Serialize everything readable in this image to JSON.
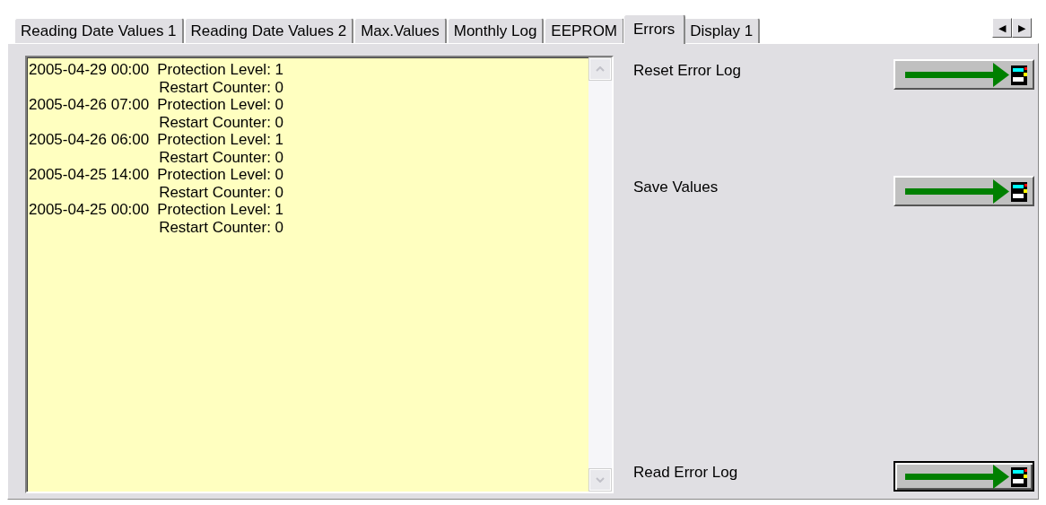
{
  "tabs": [
    {
      "label": "Reading Date Values 1",
      "selected": false
    },
    {
      "label": "Reading Date Values 2",
      "selected": false
    },
    {
      "label": "Max.Values",
      "selected": false
    },
    {
      "label": "Monthly Log",
      "selected": false
    },
    {
      "label": "EEPROM",
      "selected": false
    },
    {
      "label": "Errors",
      "selected": true
    },
    {
      "label": "Display 1",
      "selected": false
    }
  ],
  "tab_scroll": {
    "left": "◀",
    "right": "▶"
  },
  "error_log": [
    {
      "time": "2005-04-29 00:00",
      "protection": "Protection Level: 1",
      "restart": "Restart Counter: 0"
    },
    {
      "time": "2005-04-26 07:00",
      "protection": "Protection Level: 0",
      "restart": "Restart Counter: 0"
    },
    {
      "time": "2005-04-26 06:00",
      "protection": "Protection Level: 1",
      "restart": "Restart Counter: 0"
    },
    {
      "time": "2005-04-25 14:00",
      "protection": "Protection Level: 0",
      "restart": "Restart Counter: 0"
    },
    {
      "time": "2005-04-25 00:00",
      "protection": "Protection Level: 1",
      "restart": "Restart Counter: 0"
    }
  ],
  "actions": [
    {
      "label": "Reset Error Log",
      "focused": false
    },
    {
      "label": "Save Values",
      "focused": false
    },
    {
      "label": "Read Error Log",
      "focused": true
    }
  ]
}
